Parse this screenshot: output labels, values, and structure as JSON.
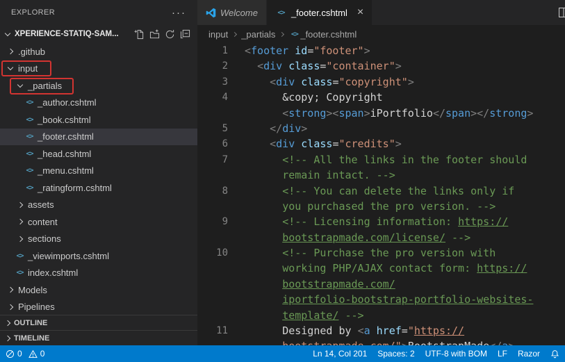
{
  "colors": {
    "accent": "#007acc",
    "annotation": "#d23431",
    "selection": "#37373d"
  },
  "annotations": [
    {
      "target": "input"
    },
    {
      "target": "_partials"
    }
  ],
  "explorer": {
    "title": "EXPLORER",
    "menu_label": "···",
    "workspace": "XPERIENCE-STATIQ-SAM...",
    "toolbar_icons": [
      "new-file-icon",
      "new-folder-icon",
      "refresh-icon",
      "collapse-all-icon"
    ],
    "tree": [
      {
        "label": ".github",
        "kind": "folder",
        "expanded": false,
        "level": 0
      },
      {
        "label": "input",
        "kind": "folder",
        "expanded": true,
        "level": 0,
        "annotated": true
      },
      {
        "label": "_partials",
        "kind": "folder",
        "expanded": true,
        "level": 1,
        "annotated": true
      },
      {
        "label": "_author.cshtml",
        "kind": "file",
        "level": 2
      },
      {
        "label": "_book.cshtml",
        "kind": "file",
        "level": 2
      },
      {
        "label": "_footer.cshtml",
        "kind": "file",
        "level": 2,
        "selected": true
      },
      {
        "label": "_head.cshtml",
        "kind": "file",
        "level": 2
      },
      {
        "label": "_menu.cshtml",
        "kind": "file",
        "level": 2
      },
      {
        "label": "_ratingform.cshtml",
        "kind": "file",
        "level": 2
      },
      {
        "label": "assets",
        "kind": "folder",
        "expanded": false,
        "level": 1
      },
      {
        "label": "content",
        "kind": "folder",
        "expanded": false,
        "level": 1
      },
      {
        "label": "sections",
        "kind": "folder",
        "expanded": false,
        "level": 1
      },
      {
        "label": "_viewimports.cshtml",
        "kind": "file",
        "level": 1
      },
      {
        "label": "index.cshtml",
        "kind": "file",
        "level": 1
      },
      {
        "label": "Models",
        "kind": "folder",
        "expanded": false,
        "level": 0
      },
      {
        "label": "Pipelines",
        "kind": "folder",
        "expanded": false,
        "level": 0
      }
    ],
    "panels": [
      {
        "label": "OUTLINE"
      },
      {
        "label": "TIMELINE"
      }
    ]
  },
  "editor": {
    "tabs": [
      {
        "label": "Welcome",
        "icon": "vscode-logo",
        "active": false,
        "preview": true,
        "closable": false
      },
      {
        "label": "_footer.cshtml",
        "icon": "code-file",
        "active": true,
        "preview": false,
        "closable": true
      }
    ],
    "breadcrumbs": [
      "input",
      "_partials",
      "_footer.cshtml"
    ],
    "lines": [
      {
        "num": "1",
        "indent": 0,
        "tokens": [
          [
            "p",
            "<"
          ],
          [
            "tag",
            "footer"
          ],
          [
            "t",
            " "
          ],
          [
            "attr",
            "id"
          ],
          [
            "eq",
            "="
          ],
          [
            "s",
            "\"footer\""
          ],
          [
            "p",
            ">"
          ]
        ]
      },
      {
        "num": "2",
        "indent": 2,
        "tokens": [
          [
            "p",
            "<"
          ],
          [
            "tag",
            "div"
          ],
          [
            "t",
            " "
          ],
          [
            "attr",
            "class"
          ],
          [
            "eq",
            "="
          ],
          [
            "s",
            "\"container\""
          ],
          [
            "p",
            ">"
          ]
        ]
      },
      {
        "num": "3",
        "indent": 4,
        "tokens": [
          [
            "p",
            "<"
          ],
          [
            "tag",
            "div"
          ],
          [
            "t",
            " "
          ],
          [
            "attr",
            "class"
          ],
          [
            "eq",
            "="
          ],
          [
            "s",
            "\"copyright\""
          ],
          [
            "p",
            ">"
          ]
        ]
      },
      {
        "num": "4",
        "indent": 6,
        "tokens": [
          [
            "t",
            "&copy; Copyright"
          ]
        ]
      },
      {
        "num": "",
        "indent": 6,
        "tokens": [
          [
            "p",
            "<"
          ],
          [
            "tag",
            "strong"
          ],
          [
            "p",
            "><"
          ],
          [
            "tag",
            "span"
          ],
          [
            "p",
            ">"
          ],
          [
            "t",
            "iPortfolio"
          ],
          [
            "p",
            "</"
          ],
          [
            "tag",
            "span"
          ],
          [
            "p",
            "></"
          ],
          [
            "tag",
            "strong"
          ],
          [
            "p",
            ">"
          ]
        ]
      },
      {
        "num": "5",
        "indent": 4,
        "tokens": [
          [
            "p",
            "</"
          ],
          [
            "tag",
            "div"
          ],
          [
            "p",
            ">"
          ]
        ]
      },
      {
        "num": "6",
        "indent": 4,
        "tokens": [
          [
            "p",
            "<"
          ],
          [
            "tag",
            "div"
          ],
          [
            "t",
            " "
          ],
          [
            "attr",
            "class"
          ],
          [
            "eq",
            "="
          ],
          [
            "s",
            "\"credits\""
          ],
          [
            "p",
            ">"
          ]
        ]
      },
      {
        "num": "7",
        "indent": 6,
        "tokens": [
          [
            "c",
            "<!-- All the links in the footer should"
          ]
        ]
      },
      {
        "num": "",
        "indent": 6,
        "tokens": [
          [
            "c",
            "remain intact. -->"
          ]
        ]
      },
      {
        "num": "8",
        "indent": 6,
        "tokens": [
          [
            "c",
            "<!-- You can delete the links only if"
          ]
        ]
      },
      {
        "num": "",
        "indent": 6,
        "tokens": [
          [
            "c",
            "you purchased the pro version. -->"
          ]
        ]
      },
      {
        "num": "9",
        "indent": 6,
        "tokens": [
          [
            "c",
            "<!-- Licensing information: "
          ],
          [
            "cl",
            "https://"
          ]
        ]
      },
      {
        "num": "",
        "indent": 6,
        "tokens": [
          [
            "cl",
            "bootstrapmade.com/license/"
          ],
          [
            "c",
            " -->"
          ]
        ]
      },
      {
        "num": "10",
        "indent": 6,
        "tokens": [
          [
            "c",
            "<!-- Purchase the pro version with"
          ]
        ]
      },
      {
        "num": "",
        "indent": 6,
        "tokens": [
          [
            "c",
            "working PHP/AJAX contact form: "
          ],
          [
            "cl",
            "https://"
          ]
        ]
      },
      {
        "num": "",
        "indent": 6,
        "tokens": [
          [
            "cl",
            "bootstrapmade.com/"
          ]
        ]
      },
      {
        "num": "",
        "indent": 6,
        "tokens": [
          [
            "cl",
            "iportfolio-bootstrap-portfolio-websites-"
          ]
        ]
      },
      {
        "num": "",
        "indent": 6,
        "tokens": [
          [
            "cl",
            "template/"
          ],
          [
            "c",
            " -->"
          ]
        ]
      },
      {
        "num": "11",
        "indent": 6,
        "tokens": [
          [
            "t",
            "Designed by "
          ],
          [
            "p",
            "<"
          ],
          [
            "tag",
            "a"
          ],
          [
            "t",
            " "
          ],
          [
            "attr",
            "href"
          ],
          [
            "eq",
            "="
          ],
          [
            "s",
            "\""
          ],
          [
            "sl",
            "https://"
          ]
        ]
      },
      {
        "num": "",
        "indent": 6,
        "tokens": [
          [
            "sl",
            "bootstrapmade.com/"
          ],
          [
            "s",
            "\""
          ],
          [
            "p",
            ">"
          ],
          [
            "t",
            "BootstrapMade"
          ],
          [
            "p",
            "</"
          ],
          [
            "tag",
            "a"
          ],
          [
            "p",
            ">"
          ]
        ]
      }
    ]
  },
  "status_bar": {
    "errors": "0",
    "warnings": "0",
    "cursor": "Ln 14, Col 201",
    "indent": "Spaces: 2",
    "encoding": "UTF-8 with BOM",
    "eol": "LF",
    "language": "Razor"
  }
}
